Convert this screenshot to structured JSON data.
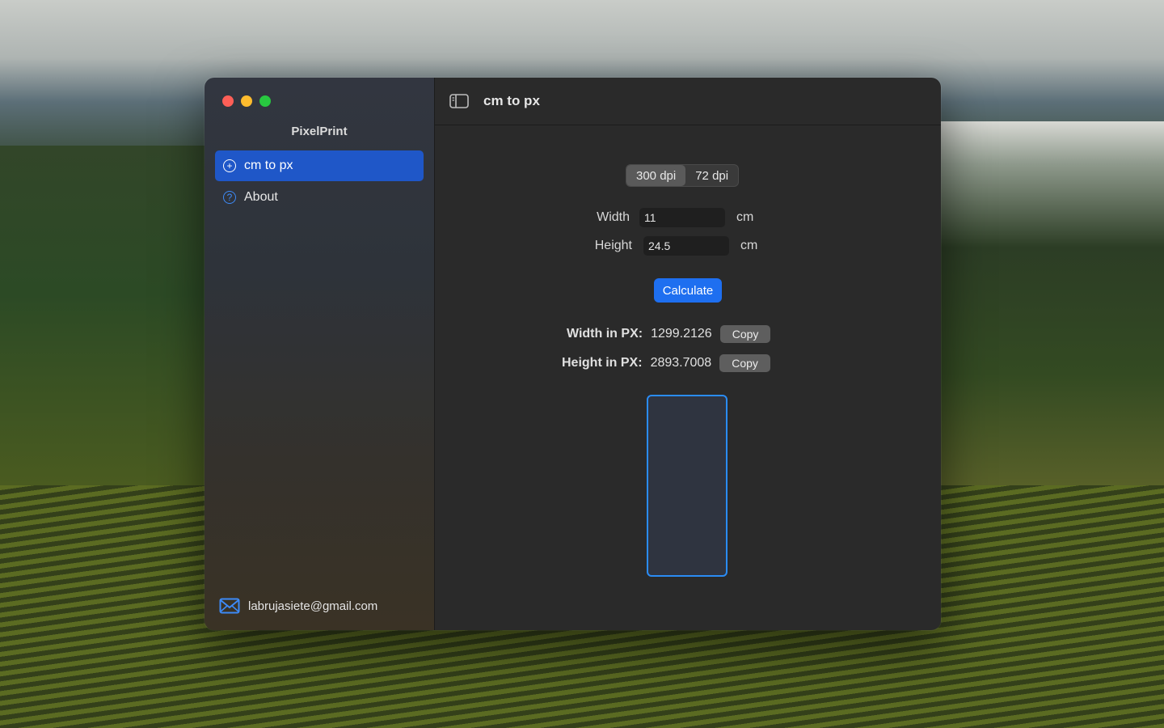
{
  "app": {
    "title": "PixelPrint"
  },
  "sidebar": {
    "items": [
      {
        "label": "cm to px",
        "icon": "plus-circle-icon",
        "selected": true
      },
      {
        "label": "About",
        "icon": "question-circle-icon",
        "selected": false
      }
    ],
    "email": "labrujasiete@gmail.com"
  },
  "toolbar": {
    "title": "cm to px",
    "sidebar_toggle_icon": "sidebar-toggle-icon"
  },
  "dpi": {
    "options": [
      "300 dpi",
      "72 dpi"
    ],
    "selected": "300 dpi"
  },
  "form": {
    "width_label": "Width",
    "width_value": "11",
    "width_unit": "cm",
    "height_label": "Height",
    "height_value": "24.5",
    "height_unit": "cm",
    "calculate_label": "Calculate"
  },
  "results": {
    "width_label": "Width in PX:",
    "width_value": "1299.2126",
    "height_label": "Height in PX:",
    "height_value": "2893.7008",
    "copy_label": "Copy"
  },
  "colors": {
    "accent": "#1f57c8",
    "button": "#1e6ff0",
    "preview_border": "#2a8cf5"
  }
}
